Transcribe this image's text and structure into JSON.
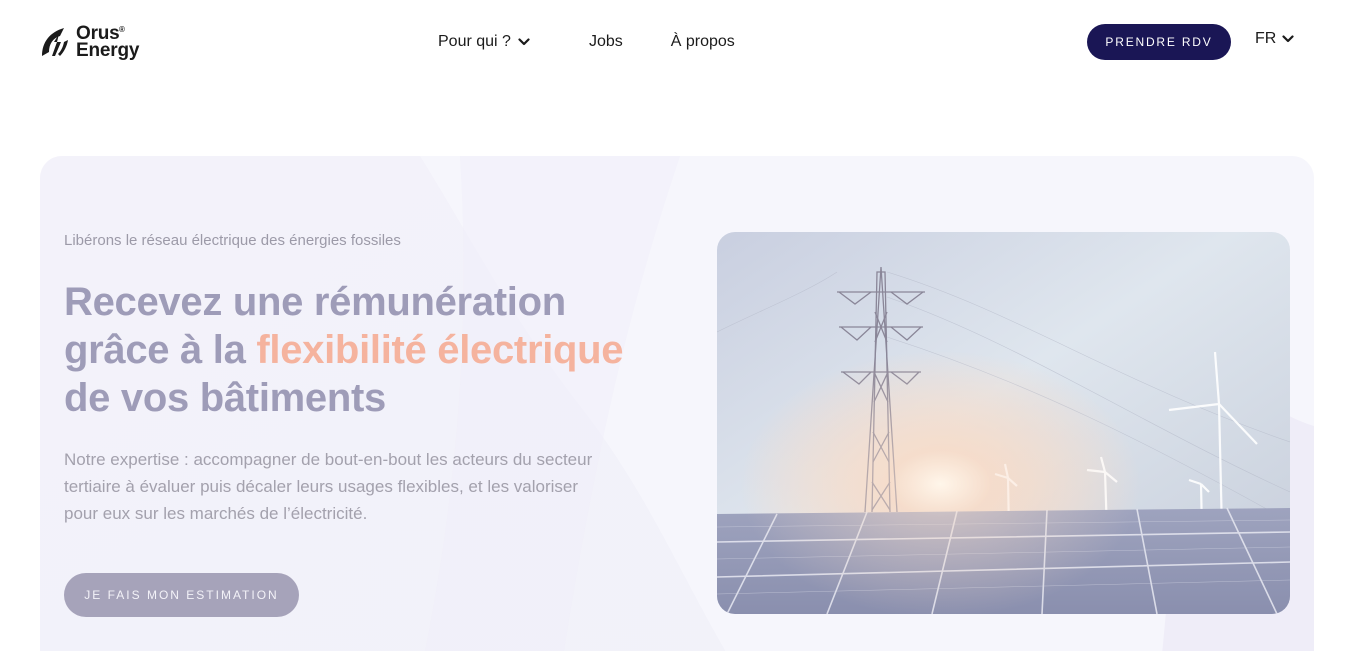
{
  "brand": {
    "name_line1": "Orus",
    "name_line2": "Energy",
    "reg": "®"
  },
  "nav": {
    "items": [
      {
        "label": "Pour qui ?"
      },
      {
        "label": "Jobs"
      },
      {
        "label": "À propos"
      }
    ],
    "cta_label": "PRENDRE RDV",
    "language": "FR"
  },
  "hero": {
    "eyebrow": "Libérons le réseau électrique des énergies fossiles",
    "headline_part1": "Recevez une rémunération grâce à la ",
    "headline_accent": "flexibilité électrique",
    "headline_part2": " de vos bâtiments",
    "description": "Notre expertise : accompagner de bout-en-bout les acteurs du secteur tertiaire à évaluer puis décaler leurs usages flexibles, et les valoriser pour eux sur les marchés de l’électricité.",
    "cta_label": "JE FAIS MON ESTIMATION"
  },
  "colors": {
    "brand_navy": "#1a1655",
    "accent_peach": "#f5b39e",
    "headline_lilac": "#9e9cb8"
  }
}
